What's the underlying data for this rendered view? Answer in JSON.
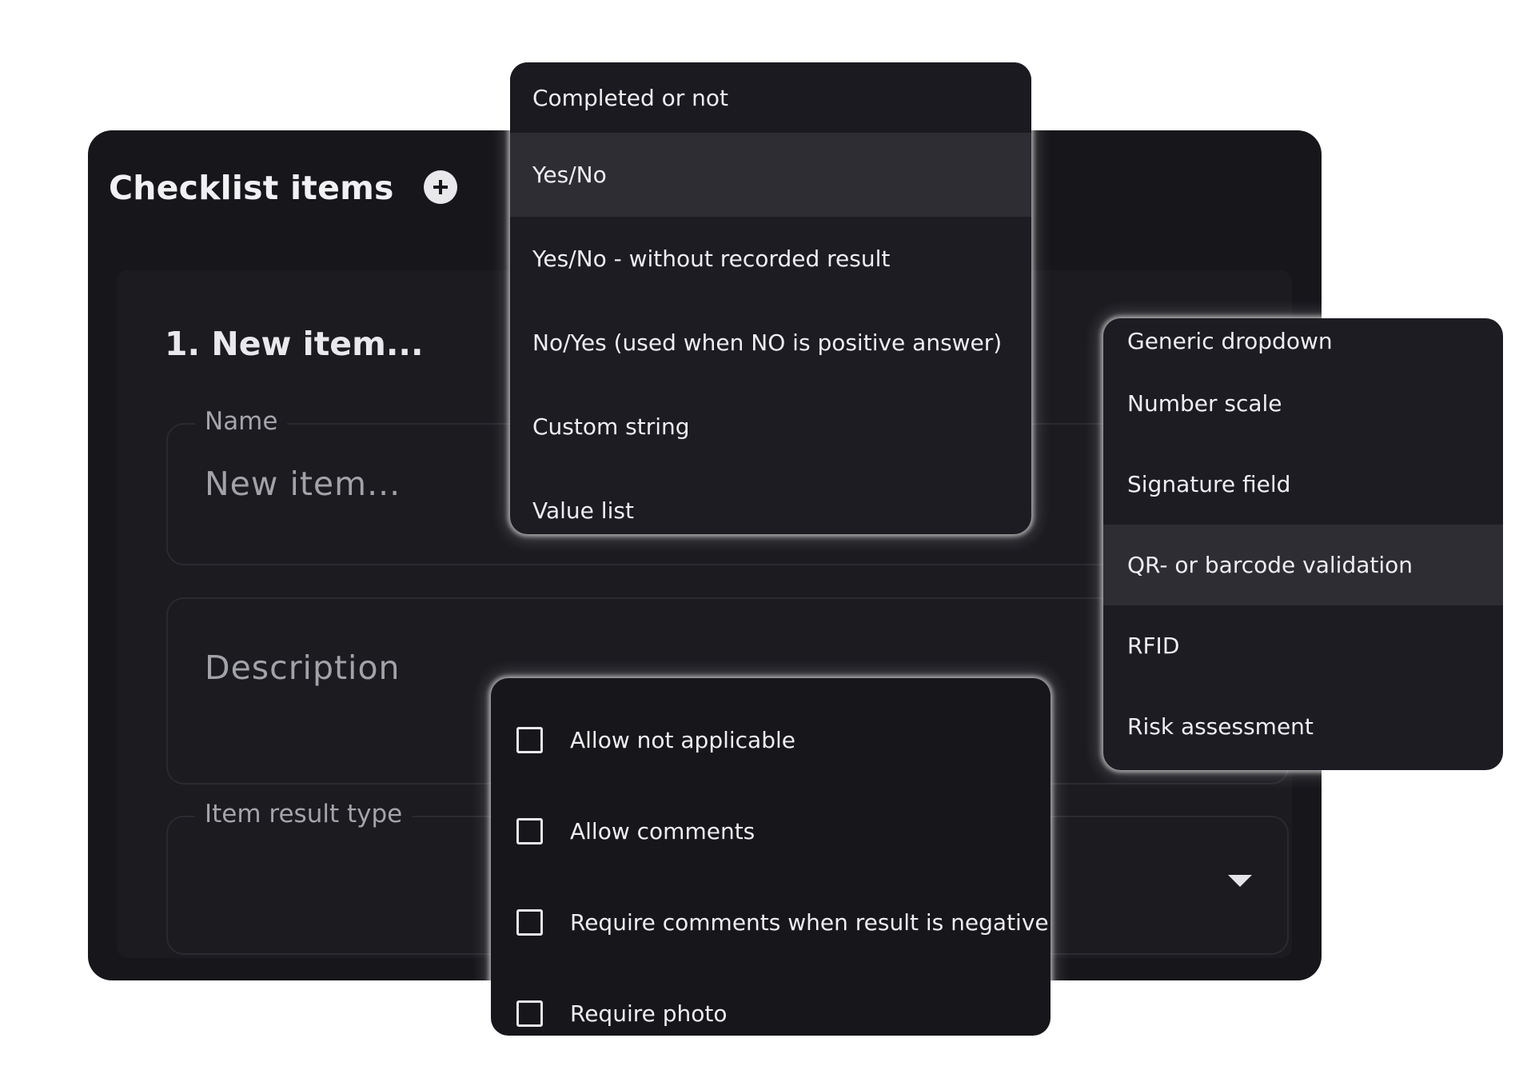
{
  "card": {
    "title": "Checklist items",
    "add_icon": "plus-circle-icon"
  },
  "item": {
    "title": "1. New item...",
    "name_label": "Name",
    "name_value": "New item...",
    "description_placeholder": "Description",
    "result_type_label": "Item result type",
    "dropdown_icon": "caret-down-icon"
  },
  "result_type_menu": {
    "options": [
      "Completed or not",
      "Yes/No",
      "Yes/No - without recorded result",
      "No/Yes (used when NO is positive answer)",
      "Custom string",
      "Value list"
    ],
    "highlighted": "Yes/No"
  },
  "more_types_menu": {
    "options": [
      "Generic dropdown",
      "Number scale",
      "Signature field",
      "QR- or barcode validation",
      "RFID",
      "Risk assessment"
    ],
    "highlighted": "QR- or barcode validation"
  },
  "options_menu": {
    "checkboxes": [
      {
        "label": "Allow not applicable",
        "checked": false
      },
      {
        "label": "Allow comments",
        "checked": false
      },
      {
        "label": "Require comments when result is negative",
        "checked": false
      },
      {
        "label": "Require photo",
        "checked": false
      }
    ]
  },
  "colors": {
    "background": "#ffffff",
    "card": "#17161b",
    "highlight": "#2e2d33",
    "text": "#efeff2",
    "muted_text": "#a4a4ab"
  }
}
